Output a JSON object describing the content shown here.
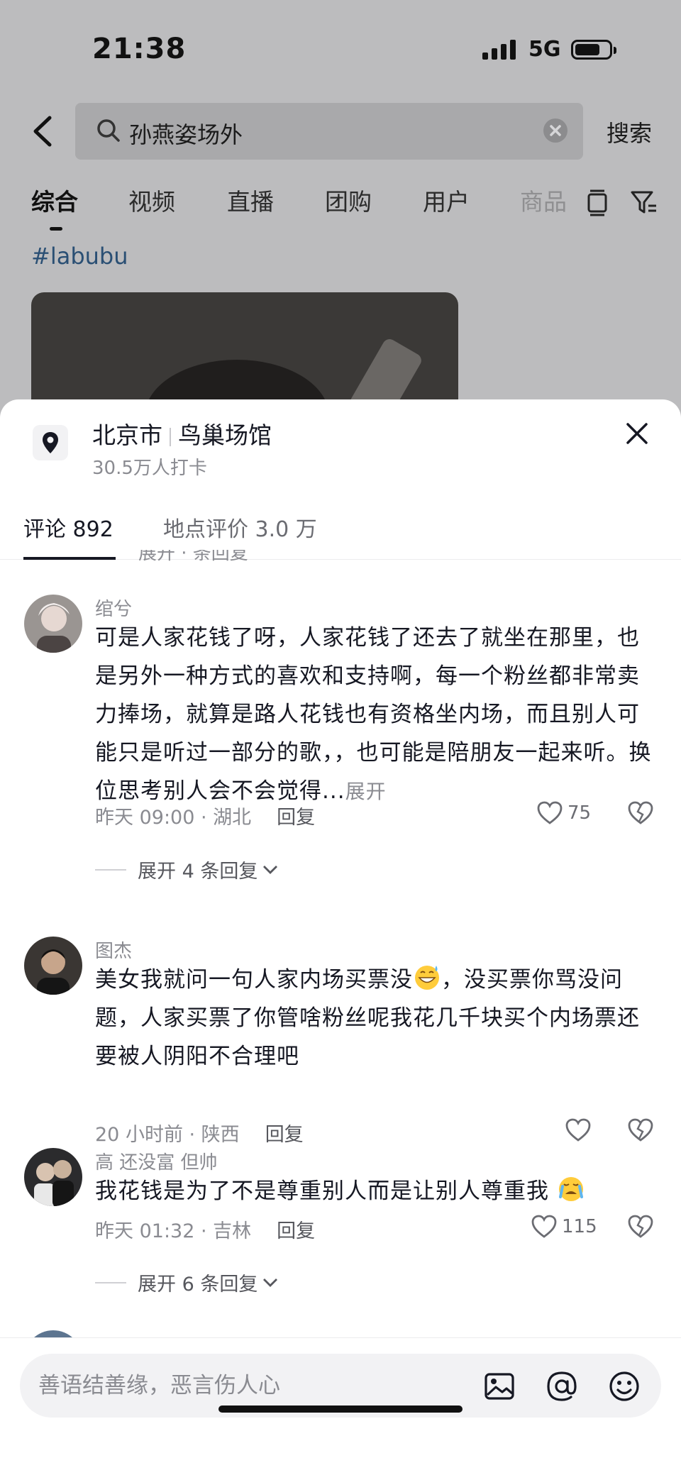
{
  "status_bar": {
    "time": "21:38",
    "network": "5G"
  },
  "search": {
    "query": "孙燕姿场外",
    "search_label": "搜索"
  },
  "result_tabs": [
    "综合",
    "视频",
    "直播",
    "团购",
    "用户",
    "商品"
  ],
  "hashtag": "#labubu",
  "sheet": {
    "location_city": "北京市",
    "location_venue": "鸟巢场馆",
    "checkins": "30.5万人打卡",
    "tab_comments": "评论 892",
    "tab_reviews": "地点评价 3.0 万",
    "cut_row_text": "展开 · 条回复"
  },
  "comments": [
    {
      "author": "绾兮",
      "text": "可是人家花钱了呀，人家花钱了还去了就坐在那里，也是另外一种方式的喜欢和支持啊，每一个粉丝都非常卖力捧场，就算是路人花钱也有资格坐内场，而且别人可能只是听过一部分的歌，，也可能是陪朋友一起来听。换位思考别人会不会觉得...",
      "expand_label": "展开",
      "meta": "昨天 09:00 · 湖北",
      "reply_label": "回复",
      "likes": "75",
      "replies_label": "展开 4 条回复"
    },
    {
      "author": "图杰",
      "text_part1": "美女我就问一句人家内场买票没",
      "text_part2": "，没买票你骂没问题，人家买票了你管啥粉丝呢我花几千块买个内场票还要被人阴阳不合理吧",
      "meta": "20 小时前 · 陕西",
      "reply_label": "回复",
      "likes": ""
    },
    {
      "author": "高 还没富 但帅",
      "text": "我花钱是为了不是尊重别人而是让别人尊重我",
      "meta": "昨天 01:32 · 吉林",
      "reply_label": "回复",
      "likes": "115",
      "replies_label": "展开 6 条回复"
    }
  ],
  "bottom_bar": {
    "placeholder": "善语结善缘，恶言伤人心"
  },
  "colors": {
    "sheet_bg": "#ffffff",
    "dim_bg": "#bcbcbe",
    "text": "#161823",
    "muted": "#8a8b91"
  }
}
